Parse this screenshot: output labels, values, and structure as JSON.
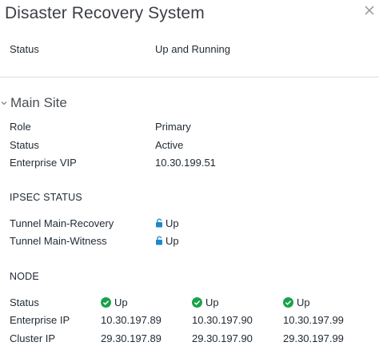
{
  "header": {
    "title": "Disaster Recovery System"
  },
  "system": {
    "status_label": "Status",
    "status_value": "Up and Running"
  },
  "main_site": {
    "title": "Main Site",
    "role_label": "Role",
    "role_value": "Primary",
    "status_label": "Status",
    "status_value": "Active",
    "vip_label": "Enterprise VIP",
    "vip_value": "10.30.199.51"
  },
  "ipsec": {
    "heading": "IPSEC STATUS",
    "tunnels": [
      {
        "label": "Tunnel Main-Recovery",
        "status": "Up"
      },
      {
        "label": "Tunnel Main-Witness",
        "status": "Up"
      }
    ]
  },
  "node": {
    "heading": "NODE",
    "row_labels": {
      "status": "Status",
      "enterprise_ip": "Enterprise IP",
      "cluster_ip": "Cluster IP"
    },
    "nodes": [
      {
        "status": "Up",
        "enterprise_ip": "10.30.197.89",
        "cluster_ip": "29.30.197.89"
      },
      {
        "status": "Up",
        "enterprise_ip": "10.30.197.90",
        "cluster_ip": "29.30.197.90"
      },
      {
        "status": "Up",
        "enterprise_ip": "10.30.197.99",
        "cluster_ip": "29.30.197.99"
      }
    ]
  },
  "colors": {
    "ok_green": "#1aa24b",
    "lock_blue": "#1e88c8",
    "divider": "#d9dde2"
  },
  "icons": {
    "close": "close-icon",
    "collapse": "chevron-down-icon",
    "lock": "unlock-icon",
    "ok": "check-circle-icon"
  }
}
